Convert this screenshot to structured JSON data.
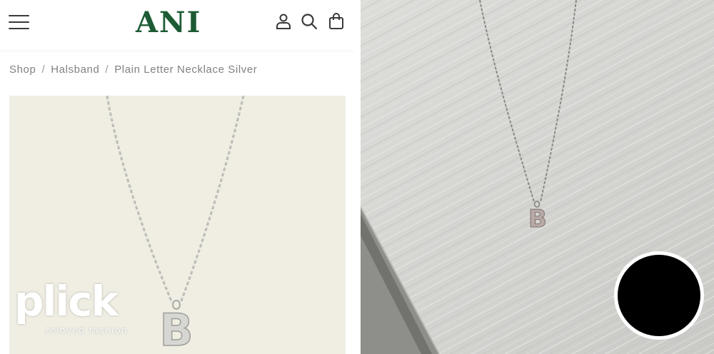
{
  "header": {
    "logo": "ANI",
    "icons": [
      "menu-icon",
      "account-icon",
      "search-icon",
      "shopping-bag-icon"
    ]
  },
  "breadcrumb": {
    "items": [
      "Shop",
      "Halsband",
      "Plain Letter Necklace Silver"
    ],
    "separator": "/"
  },
  "product": {
    "pendant_letter": "B"
  },
  "watermark": {
    "word": "plick",
    "tagline": "reloved fashion"
  },
  "photo": {
    "pendant_letter": "B"
  },
  "colors": {
    "logo": "#1d5b34",
    "product_bg": "#f0eee3",
    "breadcrumb_text": "#808080",
    "record_button": "#000000"
  }
}
